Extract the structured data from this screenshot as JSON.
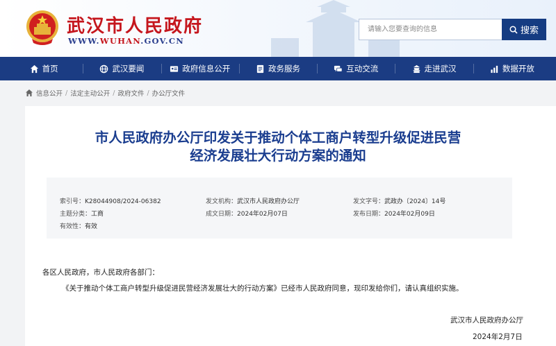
{
  "header": {
    "site_title": "武汉市人民政府",
    "site_url_prefix": "WWW.",
    "site_url_highlight": "WUHAN",
    "site_url_suffix": ".GOV.CN",
    "search_placeholder": "请输入您要查询的信息",
    "search_button": "搜索"
  },
  "nav": {
    "items": [
      {
        "label": "首页",
        "icon": "home-icon"
      },
      {
        "label": "武汉要闻",
        "icon": "globe-icon"
      },
      {
        "label": "政府信息公开",
        "icon": "id-card-icon"
      },
      {
        "label": "政务服务",
        "icon": "document-icon"
      },
      {
        "label": "互动交流",
        "icon": "chat-icon"
      },
      {
        "label": "走进武汉",
        "icon": "building-icon"
      },
      {
        "label": "数据开放",
        "icon": "chart-icon"
      }
    ]
  },
  "breadcrumb": [
    "信息公开",
    "法定主动公开",
    "政府文件",
    "办公厅文件"
  ],
  "article": {
    "title_line1": "市人民政府办公厅印发关于推动个体工商户转型升级促进民营",
    "title_line2": "经济发展壮大行动方案的通知",
    "meta": {
      "index_label": "索引号：",
      "index_value": "K28044908/2024-06382",
      "topic_label": "主题分类：",
      "topic_value": "工商",
      "validity_label": "有效性：",
      "validity_value": "有效",
      "issuer_label": "发文机构：",
      "issuer_value": "武汉市人民政府办公厅",
      "created_label": "成文日期：",
      "created_value": "2024年02月07日",
      "doc_no_label": "发文字号：",
      "doc_no_value": "武政办〔2024〕14号",
      "published_label": "发布日期：",
      "published_value": "2024年02月09日"
    },
    "salutation": "各区人民政府，市人民政府各部门：",
    "body": "《关于推动个体工商户转型升级促进民营经济发展壮大的行动方案》已经市人民政府同意，现印发给你们，请认真组织实施。",
    "signature": "武汉市人民政府办公厅",
    "sign_date": "2024年2月7日"
  },
  "colors": {
    "brand_red": "#c5161d",
    "nav_blue": "#1b3c83",
    "title_blue": "#1a3d8f"
  }
}
